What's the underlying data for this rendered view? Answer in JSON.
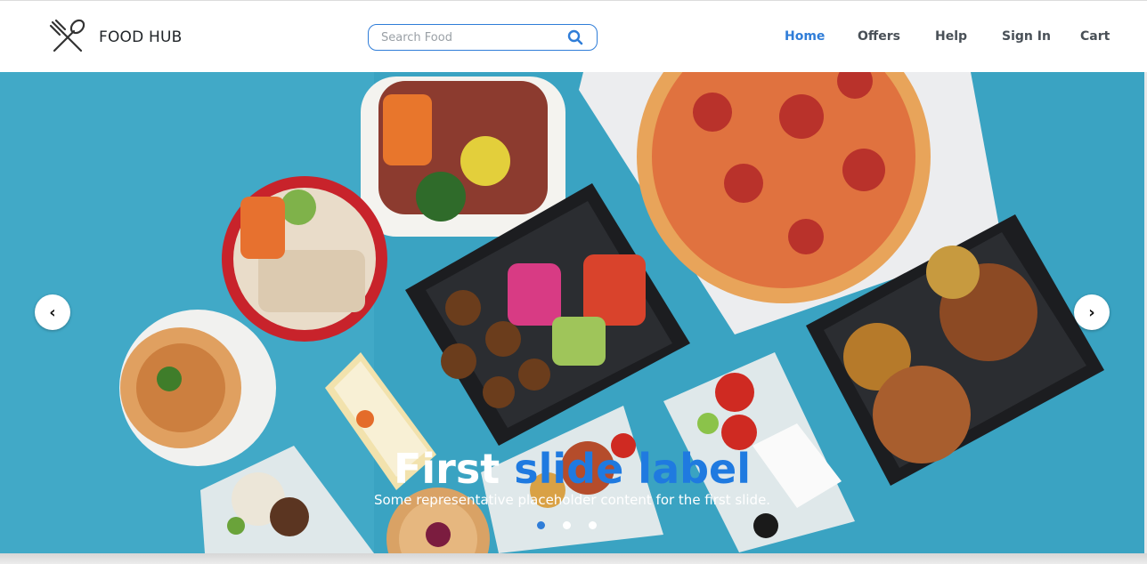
{
  "brand": {
    "name": "FOOD HUB",
    "icon": "fork-spoon-icon"
  },
  "search": {
    "placeholder": "Search Food",
    "value": "",
    "icon": "search-icon"
  },
  "nav": {
    "items": [
      {
        "label": "Home",
        "active": true
      },
      {
        "label": "Offers",
        "active": false
      },
      {
        "label": "Help",
        "active": false
      },
      {
        "label": "Sign In",
        "active": false
      },
      {
        "label": "Cart",
        "active": false
      }
    ]
  },
  "carousel": {
    "prev_label": "‹",
    "next_label": "›",
    "slide": {
      "title_first": "First ",
      "title_accent": "slide label",
      "text": "Some representative placeholder content for the first slide."
    },
    "indicators": 3,
    "active_index": 0
  },
  "colors": {
    "accent": "#2f7dd8",
    "hero_bg": "#3aa3c2",
    "text": "#495057"
  }
}
